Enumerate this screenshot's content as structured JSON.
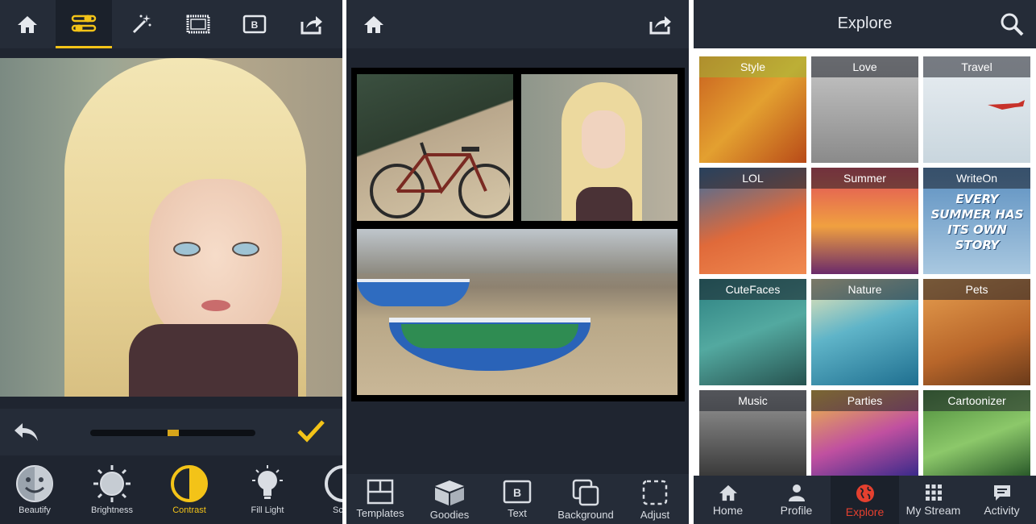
{
  "screens": {
    "editor": {
      "toolbar": [
        "home-icon",
        "adjust-sliders-icon",
        "magic-wand-icon",
        "frame-icon",
        "text-box-icon",
        "share-icon"
      ],
      "active_tool_index": 1,
      "slider_value_fraction": 0.5,
      "tools": [
        {
          "label": "Beautify",
          "icon": "beautify-face-icon"
        },
        {
          "label": "Brightness",
          "icon": "sun-icon"
        },
        {
          "label": "Contrast",
          "icon": "contrast-icon"
        },
        {
          "label": "Fill Light",
          "icon": "light-bulb-icon"
        },
        {
          "label": "Sc",
          "icon": "partial-icon"
        }
      ],
      "active_tool": "Contrast",
      "accent": "#f3c318"
    },
    "collage": {
      "toolbar": [
        "home-icon",
        "share-icon"
      ],
      "tools": [
        {
          "label": "Templates",
          "icon": "templates-icon"
        },
        {
          "label": "Goodies",
          "icon": "box-icon"
        },
        {
          "label": "Text",
          "icon": "text-box-icon"
        },
        {
          "label": "Background",
          "icon": "layers-icon"
        },
        {
          "label": "Adjust",
          "icon": "crop-dashed-icon"
        }
      ]
    },
    "explore": {
      "title": "Explore",
      "categories": [
        "Style",
        "Love",
        "Travel",
        "LOL",
        "Summer",
        "WriteOn",
        "CuteFaces",
        "Nature",
        "Pets",
        "Music",
        "Parties",
        "Cartoonizer"
      ],
      "writeon_text": "EVERY SUMMER HAS ITS OWN STORY",
      "nav": [
        {
          "label": "Home",
          "icon": "home-icon"
        },
        {
          "label": "Profile",
          "icon": "person-icon"
        },
        {
          "label": "Explore",
          "icon": "globe-icon"
        },
        {
          "label": "My Stream",
          "icon": "grid-icon"
        },
        {
          "label": "Activity",
          "icon": "chat-bubble-icon"
        }
      ],
      "active_nav": "Explore",
      "active_color": "#e4402f"
    }
  }
}
